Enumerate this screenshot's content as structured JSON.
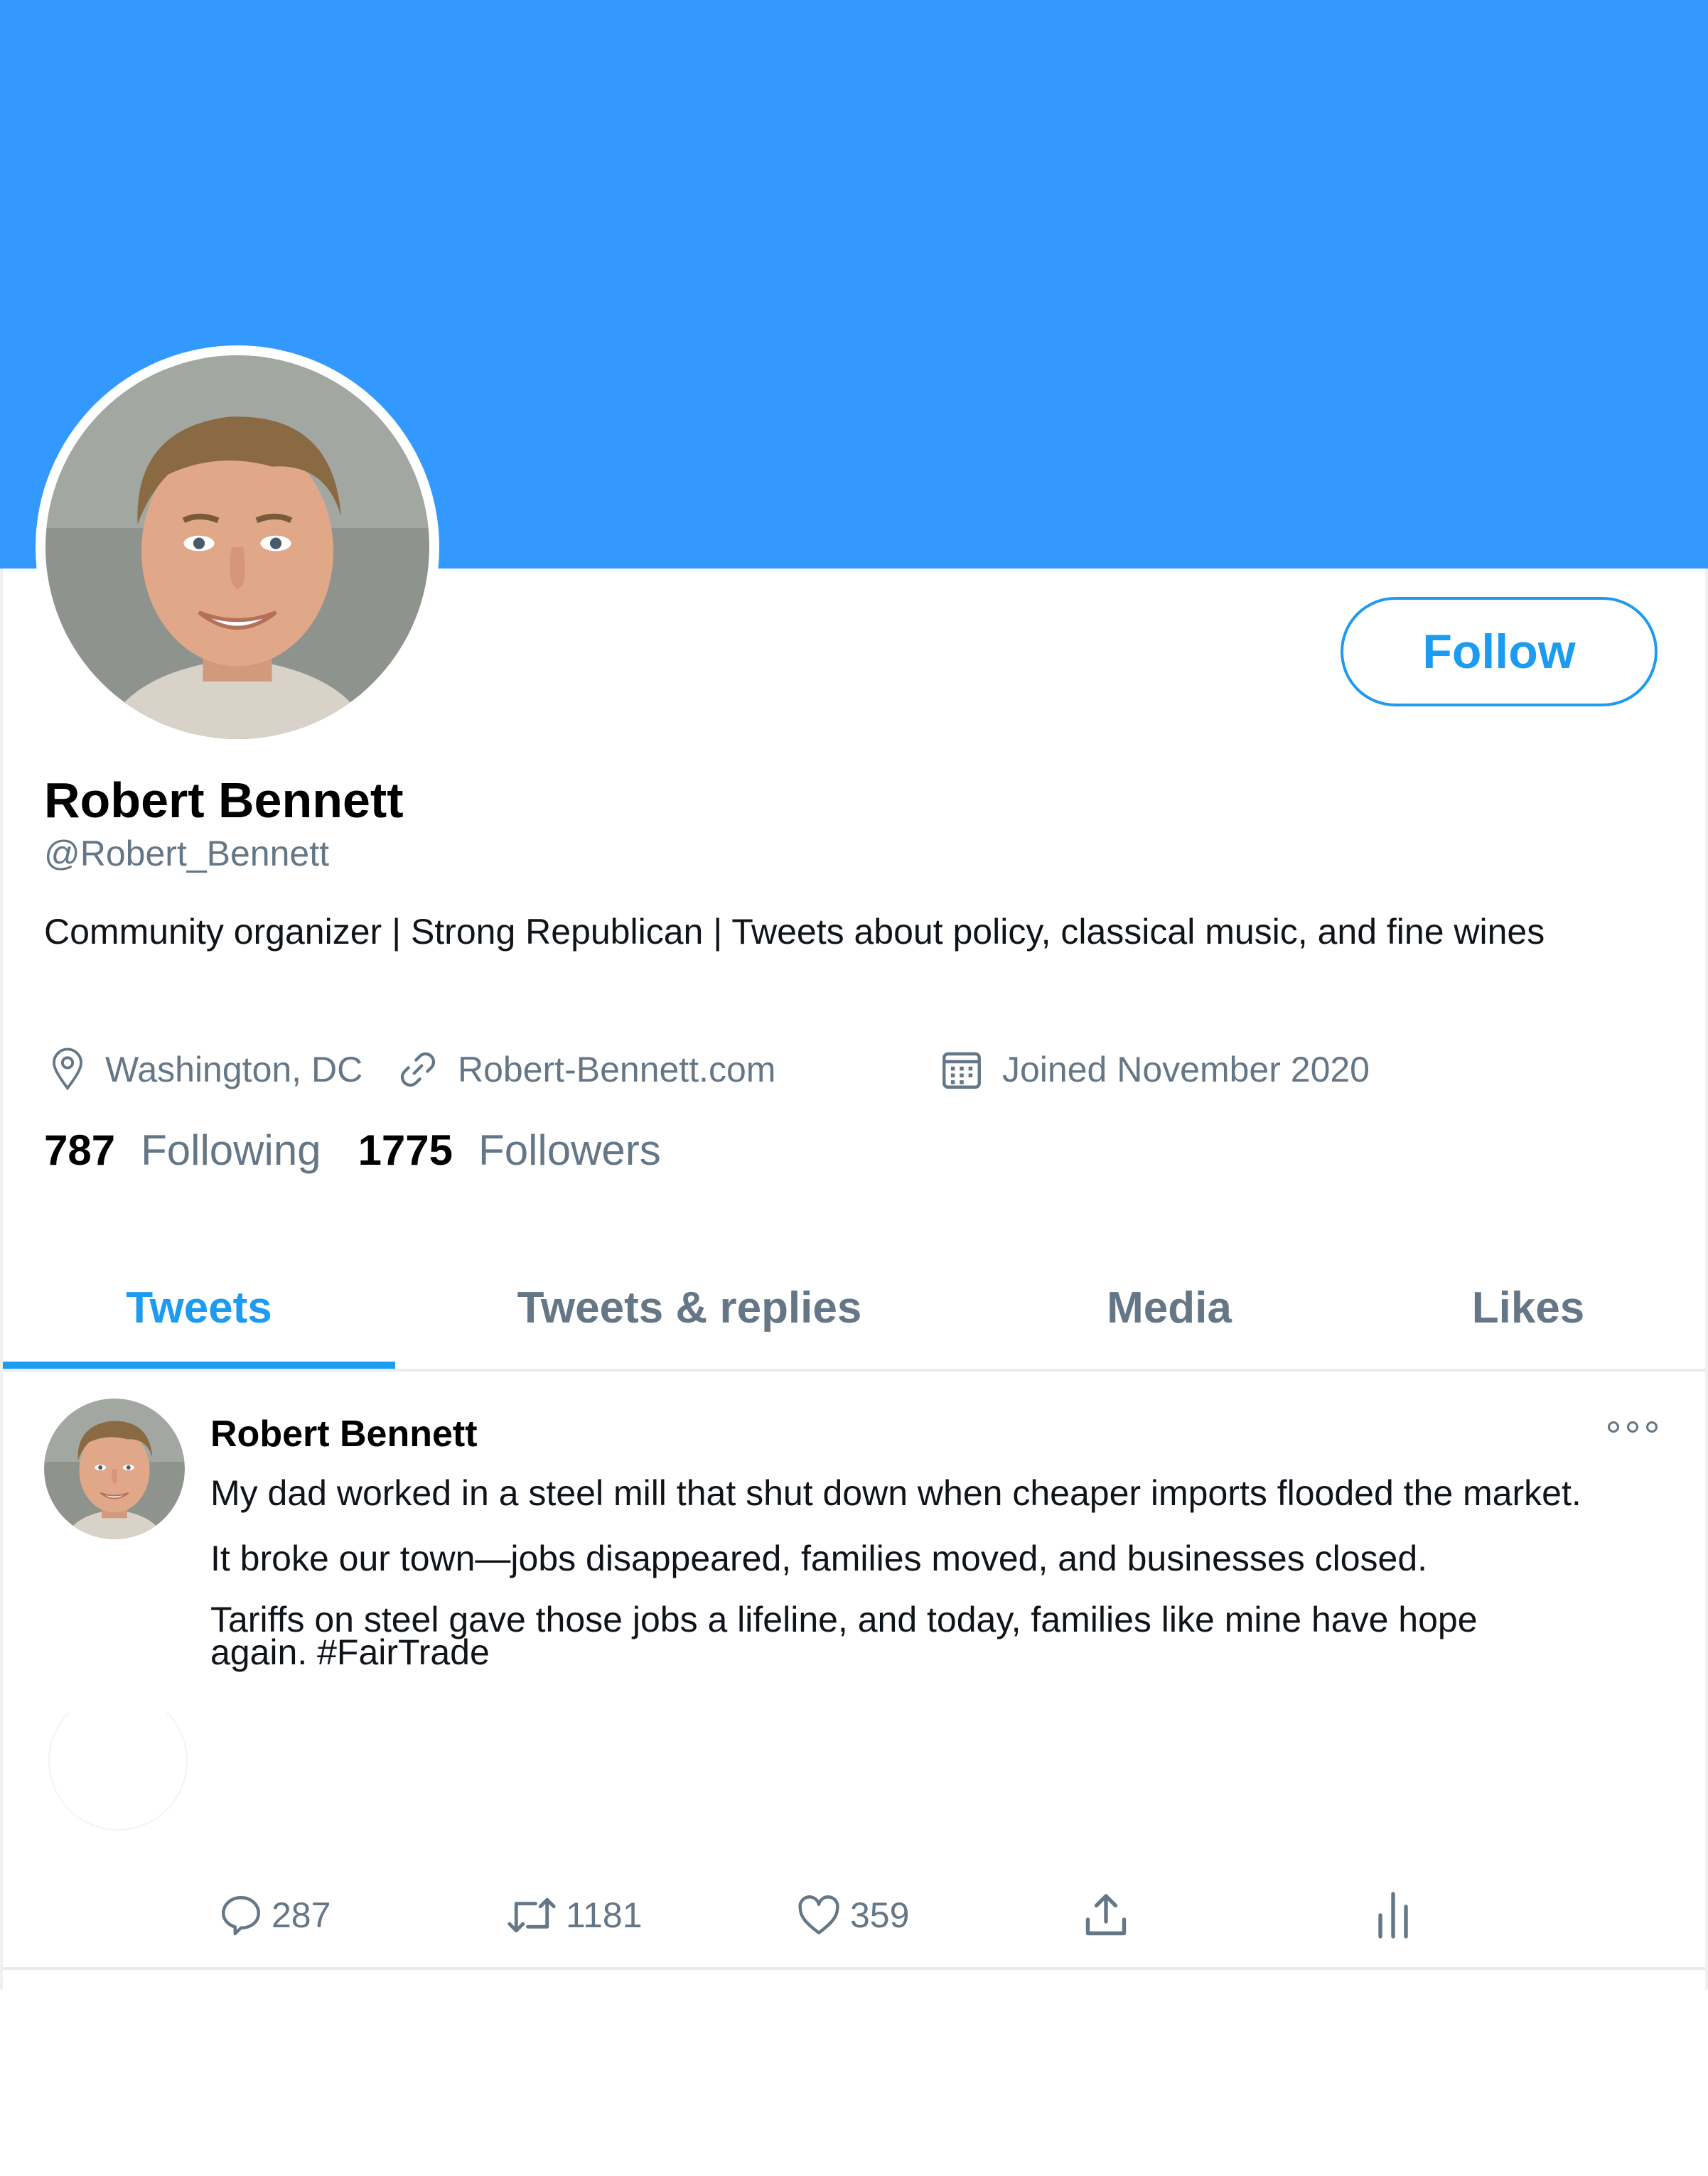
{
  "profile": {
    "display_name": "Robert Bennett",
    "handle": "@Robert_Bennett",
    "bio": "Community organizer | Strong Republican | Tweets about policy, classical music, and fine wines",
    "location": "Washington, DC",
    "website": "Robert-Bennett.com",
    "joined": "Joined November 2020",
    "following_count": "787",
    "following_label": "Following",
    "followers_count": "1775",
    "followers_label": "Followers",
    "follow_label": "Follow"
  },
  "tabs": [
    {
      "label": "Tweets",
      "active": true
    },
    {
      "label": "Tweets & replies",
      "active": false
    },
    {
      "label": "Media",
      "active": false
    },
    {
      "label": "Likes",
      "active": false
    }
  ],
  "tweet": {
    "author": "Robert Bennett",
    "lines": [
      "My dad worked in a steel mill that shut down when cheaper imports flooded the market.",
      "It broke our town—jobs disappeared, families moved, and businesses closed.",
      "Tariffs on steel gave those jobs a lifeline, and today, families like mine have hope again. #FairTrade"
    ],
    "replies": "287",
    "retweets": "1181",
    "likes": "359"
  },
  "icons": {
    "location": "location-pin-icon",
    "website": "link-icon",
    "joined": "calendar-icon",
    "reply": "reply-icon",
    "retweet": "retweet-icon",
    "like": "heart-icon",
    "share": "share-icon",
    "analytics": "analytics-icon",
    "more": "more-icon"
  },
  "colors": {
    "banner": "#3399ff",
    "accent": "#1d9bf0",
    "secondary_text": "#657786"
  }
}
